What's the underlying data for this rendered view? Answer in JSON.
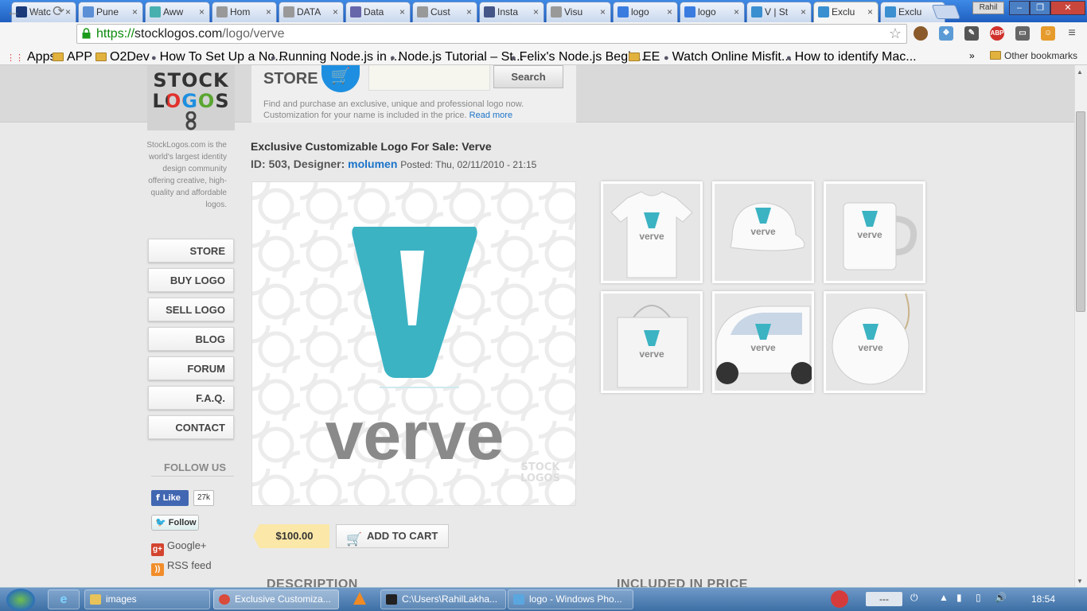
{
  "browser": {
    "tabs": [
      {
        "label": "Watc",
        "icon": "page-icon",
        "color": "#1a3a7a"
      },
      {
        "label": "Pune",
        "icon": "page-icon",
        "color": "#5b8fd6"
      },
      {
        "label": "Aww",
        "icon": "page-icon",
        "color": "#49b0b0"
      },
      {
        "label": "Hom",
        "icon": "page-icon",
        "color": "#999999"
      },
      {
        "label": "DATA",
        "icon": "google-icon",
        "color": "#999999"
      },
      {
        "label": "Data",
        "icon": "info-icon",
        "color": "#6666aa"
      },
      {
        "label": "Cust",
        "icon": "page-icon",
        "color": "#999999"
      },
      {
        "label": "Insta",
        "icon": "page-icon",
        "color": "#445588"
      },
      {
        "label": "Visu",
        "icon": "page-icon",
        "color": "#999999"
      },
      {
        "label": "logo",
        "icon": "google-icon",
        "color": "#3a7be0"
      },
      {
        "label": "logo",
        "icon": "google-icon",
        "color": "#3a7be0"
      },
      {
        "label": "V | St",
        "icon": "page-icon",
        "color": "#3a8fd0"
      },
      {
        "label": "Exclu",
        "icon": "page-icon",
        "color": "#3a8fd0",
        "active": true
      },
      {
        "label": "Exclu",
        "icon": "page-icon",
        "color": "#3a8fd0"
      }
    ],
    "user": "Rahil",
    "url_scheme": "https://",
    "url_host": "stocklogos.com",
    "url_path": "/logo/verve",
    "bookmarks": [
      {
        "label": "Apps",
        "kind": "apps"
      },
      {
        "label": "APP",
        "kind": "folder"
      },
      {
        "label": "O2Dev",
        "kind": "folder"
      },
      {
        "label": "How To Set Up a No...",
        "kind": "link"
      },
      {
        "label": "Running Node.js in ...",
        "kind": "link"
      },
      {
        "label": "Node.js Tutorial – St...",
        "kind": "link"
      },
      {
        "label": "Felix's Node.js Begin...",
        "kind": "link"
      },
      {
        "label": "EE",
        "kind": "folder"
      },
      {
        "label": "Watch Online Misfit...",
        "kind": "link"
      },
      {
        "label": "How to identify Mac...",
        "kind": "link"
      }
    ],
    "bookmarks_more": "»",
    "other_bookmarks": "Other bookmarks"
  },
  "site": {
    "logo_line1": "STOCK",
    "logo_line2": "LOGOS",
    "store_label": "STORE",
    "search_button": "Search",
    "store_desc": "Find and purchase an exclusive, unique and professional logo now. Customization for your name is included in the price.",
    "read_more": "Read more",
    "about": "StockLogos.com is the world's largest identity design community offering creative, high-quality and affordable logos.",
    "menu": [
      "STORE",
      "BUY LOGO",
      "SELL LOGO",
      "BLOG",
      "FORUM",
      "F.A.Q.",
      "CONTACT"
    ],
    "follow_us": "FOLLOW US",
    "fb_like": "Like",
    "fb_count": "27k",
    "twitter_follow": "Follow",
    "google_plus": "Google+",
    "rss": "RSS feed"
  },
  "product": {
    "title": "Exclusive Customizable Logo For Sale: Verve",
    "id_label": "ID:",
    "id_value": "503,",
    "designer_label": "Designer:",
    "designer": "molumen",
    "posted": "Posted: Thu, 02/11/2010 - 21:15",
    "logo_word": "verve",
    "logo_letter": "V",
    "watermark1": "STOCK",
    "watermark2": "LOGOS",
    "brand_teal": "#3bb3c3",
    "brand_gray": "#8a8a8a",
    "thumbnails": [
      "t-shirt",
      "cap",
      "mug",
      "shopping-bag",
      "car",
      "yo-yo"
    ],
    "price": "$100.00",
    "add_to_cart": "ADD TO CART",
    "description_header": "DESCRIPTION",
    "included_header": "INCLUDED IN PRICE"
  },
  "taskbar": {
    "items": [
      {
        "label": "images",
        "icon": "folder-icon"
      },
      {
        "label": "Exclusive Customiza...",
        "icon": "chrome-icon"
      },
      {
        "label": "C:\\Users\\RahilLakha...",
        "icon": "cmd-icon"
      },
      {
        "label": "logo - Windows Pho...",
        "icon": "photo-viewer-icon"
      }
    ],
    "tray_text": "---",
    "clock": "18:54"
  }
}
